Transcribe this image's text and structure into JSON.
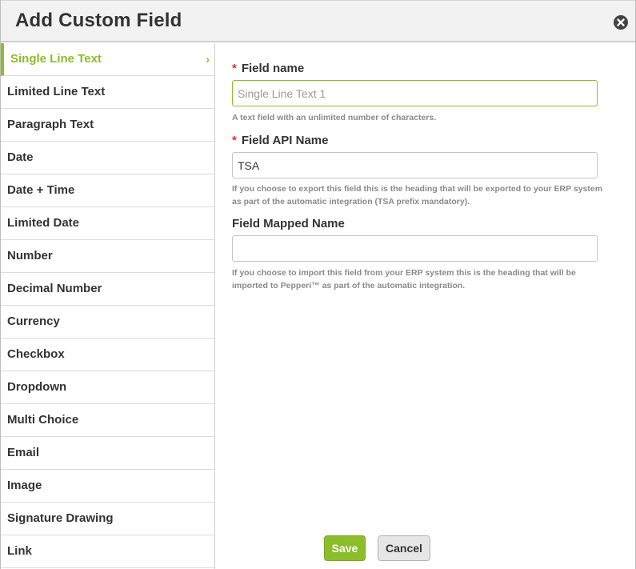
{
  "dialog": {
    "title": "Add Custom Field"
  },
  "sidebar": {
    "items": [
      {
        "label": "Single Line Text",
        "active": true
      },
      {
        "label": "Limited Line Text"
      },
      {
        "label": "Paragraph Text"
      },
      {
        "label": "Date"
      },
      {
        "label": "Date + Time"
      },
      {
        "label": "Limited Date"
      },
      {
        "label": "Number"
      },
      {
        "label": "Decimal Number"
      },
      {
        "label": "Currency"
      },
      {
        "label": "Checkbox"
      },
      {
        "label": "Dropdown"
      },
      {
        "label": "Multi Choice"
      },
      {
        "label": "Email"
      },
      {
        "label": "Image"
      },
      {
        "label": "Signature Drawing"
      },
      {
        "label": "Link"
      }
    ],
    "active_chevron": "›"
  },
  "form": {
    "required_marker": "*",
    "field_name": {
      "label": "Field name",
      "placeholder": "Single Line Text 1",
      "value": "",
      "help": "A text field with an unlimited number of characters."
    },
    "field_api_name": {
      "label": "Field API Name",
      "value": "TSA",
      "help": "If you choose to export this field this is the heading that will be exported to your ERP system as part of the automatic integration (TSA prefix mandatory)."
    },
    "field_mapped_name": {
      "label": "Field Mapped Name",
      "value": "",
      "help": "If you choose to import this field from your ERP system this is the heading that will be imported to Pepperi™ as part of the automatic integration."
    }
  },
  "footer": {
    "save_label": "Save",
    "cancel_label": "Cancel"
  },
  "colors": {
    "accent": "#8cbd2a",
    "required": "#d9342b"
  }
}
